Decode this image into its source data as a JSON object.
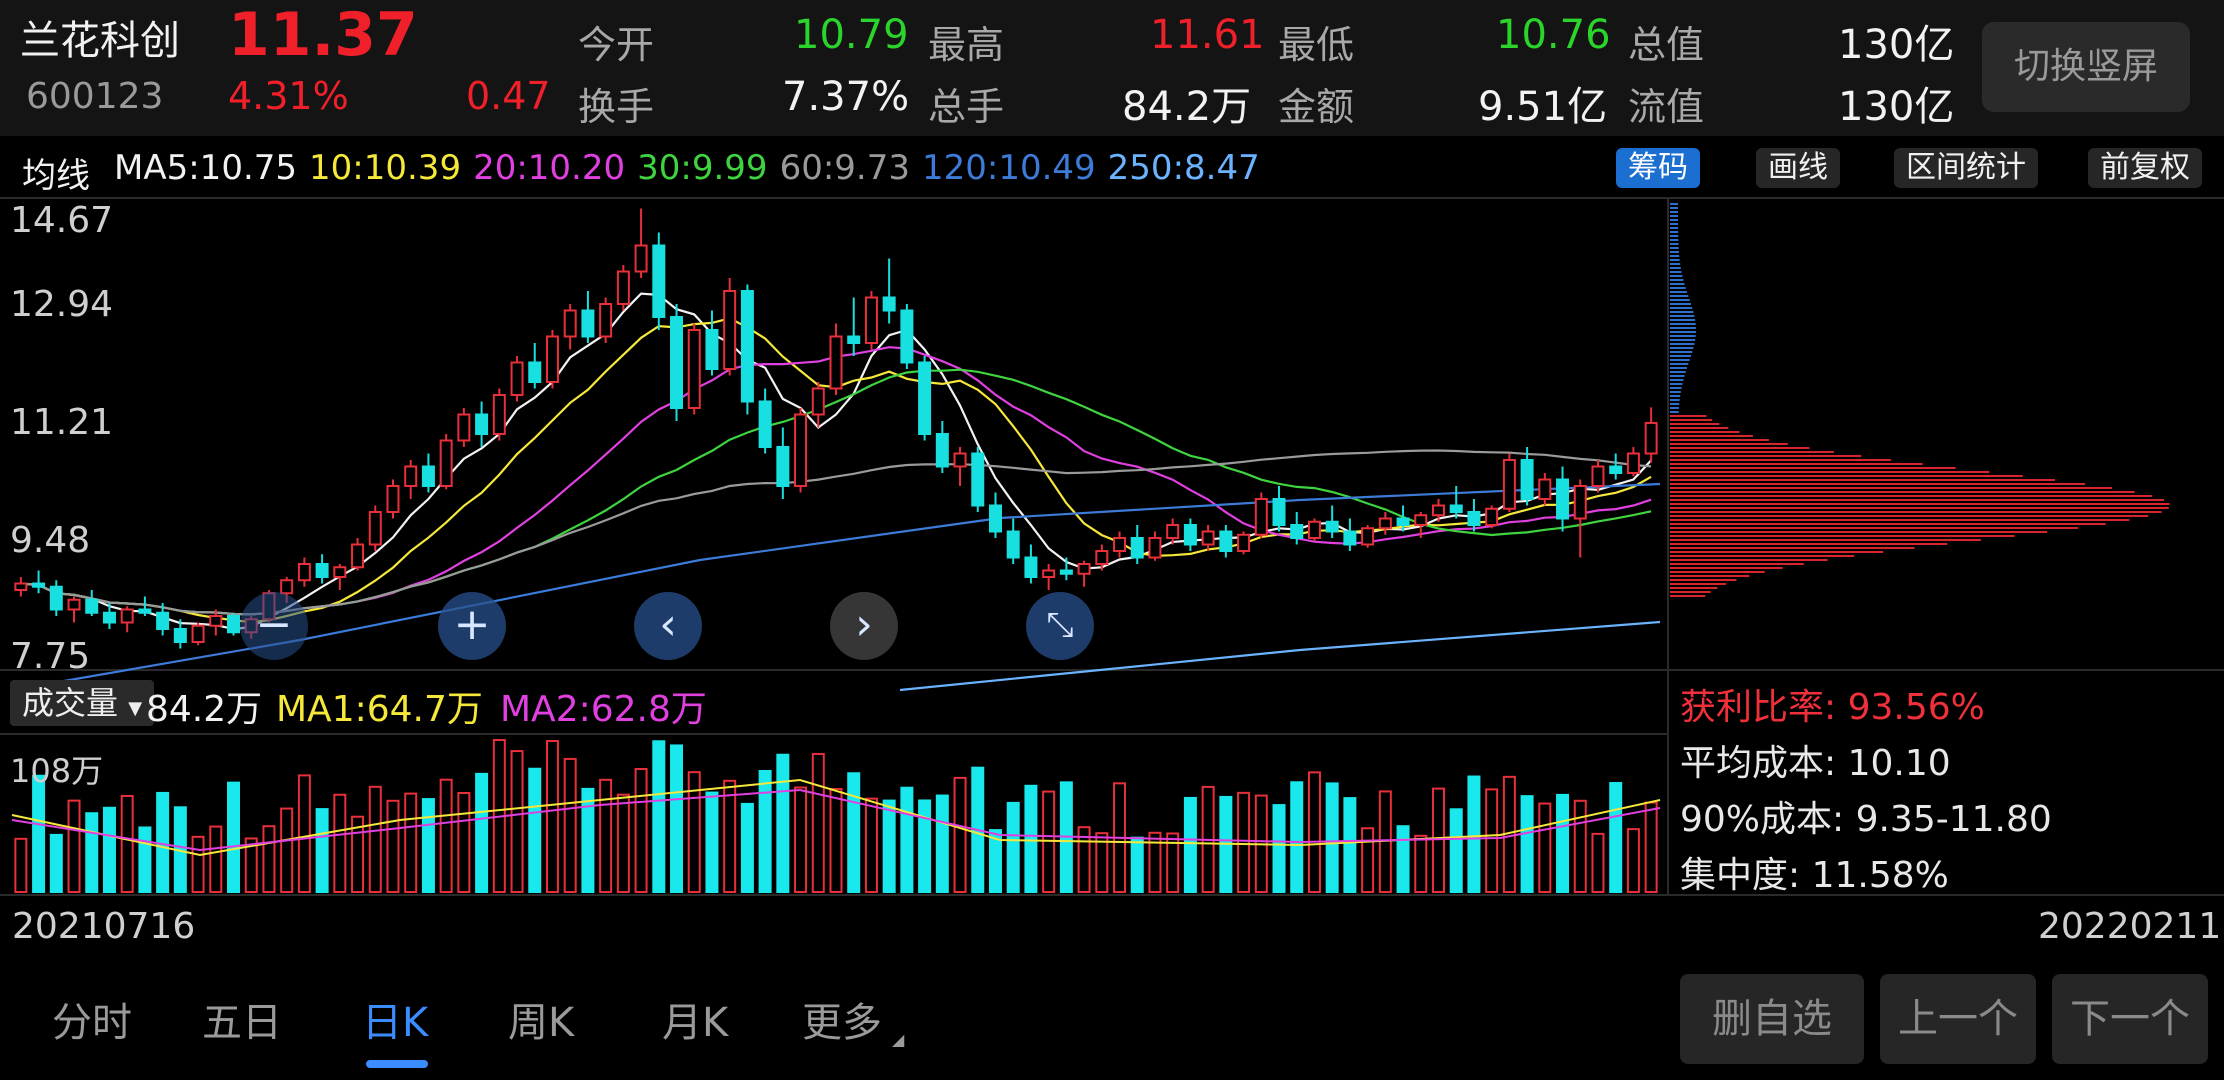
{
  "stock": {
    "name": "兰花科创",
    "code": "600123",
    "price": "11.37",
    "change_pct": "4.31%",
    "change": "0.47"
  },
  "quote": {
    "open_label": "今开",
    "open": "10.79",
    "high_label": "最高",
    "high": "11.61",
    "low_label": "最低",
    "low": "10.76",
    "mktcap_label": "总值",
    "mktcap": "130亿",
    "turnover_label": "换手",
    "turnover": "7.37%",
    "volume_label": "总手",
    "volume": "84.2万",
    "amount_label": "金额",
    "amount": "9.51亿",
    "float_label": "流值",
    "float": "130亿"
  },
  "switch_button": "切换竖屏",
  "ma_bar": {
    "label": "均线",
    "items": [
      {
        "text": "MA5:10.75",
        "color": "#f2f2f2"
      },
      {
        "text": "10:10.39",
        "color": "#f5e83a"
      },
      {
        "text": "20:10.20",
        "color": "#e040e0"
      },
      {
        "text": "30:9.99",
        "color": "#3fd43f"
      },
      {
        "text": "60:9.73",
        "color": "#9a9a9a"
      },
      {
        "text": "120:10.49",
        "color": "#3d7bd9"
      },
      {
        "text": "250:8.47",
        "color": "#6ab4ff"
      }
    ]
  },
  "top_buttons": [
    "筹码",
    "画线",
    "区间统计",
    "前复权"
  ],
  "price_axis": [
    "14.67",
    "12.94",
    "11.21",
    "9.48",
    "7.75"
  ],
  "volume_bar": {
    "label": "成交量",
    "value": "84.2万",
    "ma1": "MA1:64.7万",
    "ma2": "MA2:62.8万",
    "axis_max": "108万"
  },
  "chip": {
    "profit_ratio": "获利比率: 93.56%",
    "avg_cost": "平均成本: 10.10",
    "cost90": "90%成本:  9.35-11.80",
    "concentration": "集中度: 11.58%"
  },
  "dates": {
    "start": "20210716",
    "end": "20220211"
  },
  "period_tabs": [
    "分时",
    "五日",
    "日K",
    "周K",
    "月K",
    "更多"
  ],
  "active_tab": "日K",
  "bottom_buttons": [
    "删自选",
    "上一个",
    "下一个"
  ],
  "nav_icons": [
    "minus-icon",
    "plus-icon",
    "chevron-left-icon",
    "chevron-right-icon",
    "shrink-icon"
  ],
  "chart_data": {
    "type": "candlestick",
    "ylim": [
      7.75,
      14.67
    ],
    "start_date": "20210716",
    "end_date": "20220211",
    "ohlc_approx": [
      [
        8.8,
        9.0,
        8.7,
        8.9
      ],
      [
        8.9,
        9.1,
        8.75,
        8.85
      ],
      [
        8.85,
        8.95,
        8.4,
        8.5
      ],
      [
        8.5,
        8.7,
        8.3,
        8.65
      ],
      [
        8.65,
        8.8,
        8.4,
        8.45
      ],
      [
        8.45,
        8.6,
        8.2,
        8.3
      ],
      [
        8.3,
        8.55,
        8.15,
        8.5
      ],
      [
        8.5,
        8.7,
        8.4,
        8.45
      ],
      [
        8.45,
        8.6,
        8.1,
        8.2
      ],
      [
        8.2,
        8.35,
        7.9,
        8.0
      ],
      [
        8.0,
        8.3,
        7.95,
        8.25
      ],
      [
        8.25,
        8.5,
        8.1,
        8.4
      ],
      [
        8.4,
        8.45,
        8.1,
        8.15
      ],
      [
        8.15,
        8.4,
        8.05,
        8.35
      ],
      [
        8.35,
        8.8,
        8.3,
        8.75
      ],
      [
        8.75,
        9.0,
        8.6,
        8.95
      ],
      [
        8.95,
        9.3,
        8.85,
        9.2
      ],
      [
        9.2,
        9.35,
        8.9,
        9.0
      ],
      [
        9.0,
        9.2,
        8.8,
        9.15
      ],
      [
        9.15,
        9.6,
        9.1,
        9.5
      ],
      [
        9.5,
        10.1,
        9.4,
        10.0
      ],
      [
        10.0,
        10.5,
        9.9,
        10.4
      ],
      [
        10.4,
        10.8,
        10.2,
        10.7
      ],
      [
        10.7,
        10.9,
        10.3,
        10.4
      ],
      [
        10.4,
        11.2,
        10.35,
        11.1
      ],
      [
        11.1,
        11.6,
        11.0,
        11.5
      ],
      [
        11.5,
        11.7,
        11.0,
        11.2
      ],
      [
        11.2,
        11.9,
        11.1,
        11.8
      ],
      [
        11.8,
        12.4,
        11.7,
        12.3
      ],
      [
        12.3,
        12.6,
        11.9,
        12.0
      ],
      [
        12.0,
        12.8,
        11.9,
        12.7
      ],
      [
        12.7,
        13.2,
        12.5,
        13.1
      ],
      [
        13.1,
        13.4,
        12.6,
        12.7
      ],
      [
        12.7,
        13.3,
        12.6,
        13.2
      ],
      [
        13.2,
        13.8,
        13.1,
        13.7
      ],
      [
        13.7,
        14.67,
        13.6,
        14.1
      ],
      [
        14.1,
        14.3,
        12.8,
        13.0
      ],
      [
        13.0,
        13.2,
        11.4,
        11.6
      ],
      [
        11.6,
        12.9,
        11.5,
        12.8
      ],
      [
        12.8,
        13.1,
        12.1,
        12.2
      ],
      [
        12.2,
        13.6,
        12.1,
        13.4
      ],
      [
        13.4,
        13.5,
        11.5,
        11.7
      ],
      [
        11.7,
        11.9,
        10.9,
        11.0
      ],
      [
        11.0,
        11.3,
        10.2,
        10.4
      ],
      [
        10.4,
        11.6,
        10.3,
        11.5
      ],
      [
        11.5,
        12.0,
        11.3,
        11.9
      ],
      [
        11.9,
        12.9,
        11.8,
        12.7
      ],
      [
        12.7,
        13.3,
        12.4,
        12.6
      ],
      [
        12.6,
        13.4,
        12.5,
        13.3
      ],
      [
        13.3,
        13.9,
        12.9,
        13.1
      ],
      [
        13.1,
        13.2,
        12.2,
        12.3
      ],
      [
        12.3,
        12.4,
        11.1,
        11.2
      ],
      [
        11.2,
        11.4,
        10.6,
        10.7
      ],
      [
        10.7,
        11.0,
        10.4,
        10.9
      ],
      [
        10.9,
        11.0,
        10.0,
        10.1
      ],
      [
        10.1,
        10.3,
        9.6,
        9.7
      ],
      [
        9.7,
        9.9,
        9.2,
        9.3
      ],
      [
        9.3,
        9.5,
        8.9,
        9.0
      ],
      [
        9.0,
        9.2,
        8.8,
        9.1
      ],
      [
        9.1,
        9.3,
        8.95,
        9.05
      ],
      [
        9.05,
        9.25,
        8.85,
        9.2
      ],
      [
        9.2,
        9.5,
        9.1,
        9.4
      ],
      [
        9.4,
        9.7,
        9.3,
        9.6
      ],
      [
        9.6,
        9.8,
        9.2,
        9.3
      ],
      [
        9.3,
        9.7,
        9.25,
        9.6
      ],
      [
        9.6,
        9.9,
        9.5,
        9.8
      ],
      [
        9.8,
        9.9,
        9.4,
        9.5
      ],
      [
        9.5,
        9.8,
        9.4,
        9.7
      ],
      [
        9.7,
        9.8,
        9.3,
        9.4
      ],
      [
        9.4,
        9.7,
        9.35,
        9.65
      ],
      [
        9.65,
        10.3,
        9.6,
        10.2
      ],
      [
        10.2,
        10.4,
        9.7,
        9.8
      ],
      [
        9.8,
        10.0,
        9.5,
        9.6
      ],
      [
        9.6,
        9.9,
        9.55,
        9.85
      ],
      [
        9.85,
        10.1,
        9.6,
        9.7
      ],
      [
        9.7,
        9.9,
        9.4,
        9.5
      ],
      [
        9.5,
        9.8,
        9.45,
        9.75
      ],
      [
        9.75,
        10.0,
        9.65,
        9.9
      ],
      [
        9.9,
        10.1,
        9.7,
        9.8
      ],
      [
        9.8,
        10.0,
        9.6,
        9.95
      ],
      [
        9.95,
        10.2,
        9.85,
        10.1
      ],
      [
        10.1,
        10.4,
        9.9,
        10.0
      ],
      [
        10.0,
        10.2,
        9.7,
        9.8
      ],
      [
        9.8,
        10.1,
        9.75,
        10.05
      ],
      [
        10.05,
        10.9,
        10.0,
        10.8
      ],
      [
        10.8,
        11.0,
        10.1,
        10.2
      ],
      [
        10.2,
        10.6,
        10.1,
        10.5
      ],
      [
        10.5,
        10.7,
        9.7,
        9.9
      ],
      [
        9.9,
        10.5,
        9.3,
        10.4
      ],
      [
        10.4,
        10.8,
        10.3,
        10.7
      ],
      [
        10.7,
        10.9,
        10.5,
        10.6
      ],
      [
        10.6,
        11.0,
        10.55,
        10.9
      ],
      [
        10.9,
        11.61,
        10.76,
        11.37
      ]
    ]
  }
}
